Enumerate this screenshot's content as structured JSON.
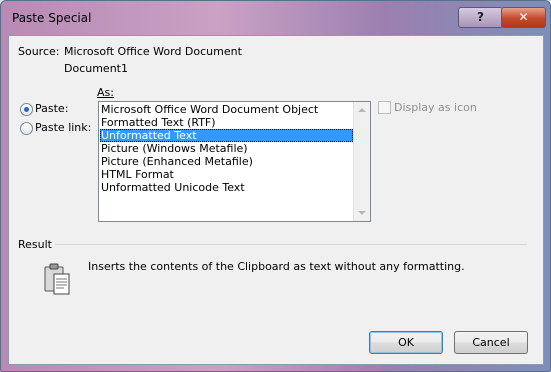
{
  "window": {
    "title": "Paste Special"
  },
  "titlebar": {
    "help": "?",
    "close": "✕"
  },
  "source": {
    "label": "Source:",
    "line1": "Microsoft Office Word Document",
    "line2": "Document1"
  },
  "as_label": "As:",
  "options": {
    "paste": {
      "label": "Paste:",
      "checked": true
    },
    "paste_link": {
      "label": "Paste link:",
      "checked": false
    }
  },
  "list": {
    "items": [
      "Microsoft Office Word Document Object",
      "Formatted Text (RTF)",
      "Unformatted Text",
      "Picture (Windows Metafile)",
      "Picture (Enhanced Metafile)",
      "HTML Format",
      "Unformatted Unicode Text"
    ],
    "selected_index": 2
  },
  "display_as_icon": {
    "label": "Display as icon",
    "checked": false,
    "enabled": false
  },
  "result": {
    "label": "Result",
    "text": "Inserts the contents of the Clipboard as text without any formatting."
  },
  "buttons": {
    "ok": "OK",
    "cancel": "Cancel"
  },
  "colors": {
    "selection": "#3399ff",
    "disabled_text": "#8f8f8f",
    "title_gradient": "#b88ab5"
  },
  "icons": {
    "result_icon": "clipboard-icon",
    "close_icon": "close-icon",
    "help_icon": "help-icon"
  }
}
